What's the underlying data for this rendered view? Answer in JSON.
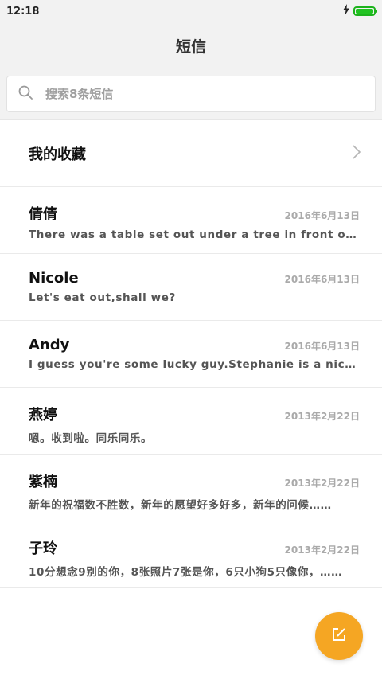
{
  "status_bar": {
    "time": "12:18"
  },
  "header": {
    "title": "短信"
  },
  "search": {
    "placeholder": "搜索8条短信"
  },
  "favorites": {
    "label": "我的收藏"
  },
  "messages": [
    {
      "name": "倩倩",
      "date": "2016年6月13日",
      "preview": "There was a table set out under a tree in front of the house"
    },
    {
      "name": "Nicole",
      "date": "2016年6月13日",
      "preview": "Let's eat out,shall we?"
    },
    {
      "name": "Andy",
      "date": "2016年6月13日",
      "preview": "I guess you're some lucky guy.Stephanie is a nice girl."
    },
    {
      "name": "燕婷",
      "date": "2013年2月22日",
      "preview": "嗯。收到啦。同乐同乐。"
    },
    {
      "name": "紫楠",
      "date": "2013年2月22日",
      "preview": "新年的祝福数不胜数，新年的愿望好多好多，新年的问候……"
    },
    {
      "name": "子玲",
      "date": "2013年2月22日",
      "preview": "10分想念9别的你，8张照片7张是你，6只小狗5只像你，……"
    }
  ],
  "colors": {
    "accent": "#f5a623",
    "battery": "#22c322"
  }
}
